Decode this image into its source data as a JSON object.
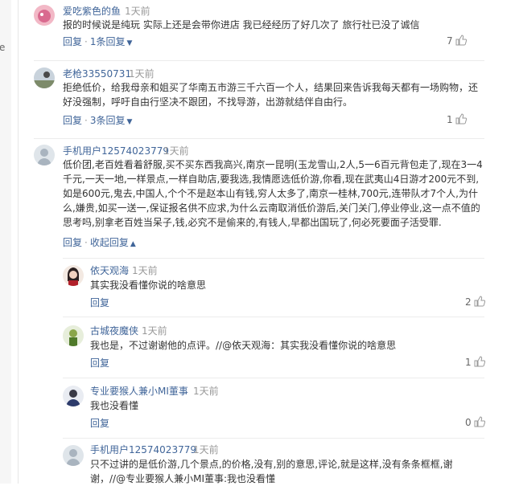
{
  "sidebar": {
    "stub": "e"
  },
  "comments": [
    {
      "user": "爱吃紫色的鱼",
      "time": "1天前",
      "text": "报的时候说是纯玩 实际上还是会带你进店 我已经经历了好几次了 旅行社已没了诚信",
      "reply": "回复",
      "expand": "1条回复",
      "likes": "7"
    },
    {
      "user": "老枪33550731",
      "time": "1天前",
      "text": "拒绝低价，给我母亲和姐买了华南五市游三千六百一个人，结果回来告诉我每天都有一场购物，还好没强制，呼吁自由行坚决不跟团，不找导游，出游就结伴自由行。",
      "reply": "回复",
      "expand": "3条回复",
      "likes": "1"
    },
    {
      "user": "手机用户12574023779",
      "time": "1天前",
      "text": "低价团,老百姓看着舒服,买不买东西我高兴,南京一昆明(玉龙雪山,2人,5一6百元背包走了,现在3一4千元,一天一地,一样景点,一样自助店,要我选,我情愿选低价游,你看,现在武夷山4日游才200元不到,如是600元,鬼去,中国人,个个不是赵本山有钱,穷人太多了,南京一桂林,700元,连带队才7个人,为什么,嫌贵,如买一送一,保证报名供不应求,为什么云南取消低价游后,关门关门,停业停业,这一点不值的思考吗,别拿老百姓当呆子,钱,必究不是偷来的,有钱人,早都出国玩了,何必死要面子活受罪.",
      "reply": "回复",
      "expand": "收起回复",
      "likes": "",
      "subreplies": [
        {
          "user": "依天观海",
          "time": "1天前",
          "text": "其实我没看懂你说的啥意思",
          "reply": "回复",
          "likes": "2"
        },
        {
          "user": "古城夜魔侠",
          "time": "1天前",
          "text": "我也是，不过谢谢他的点评。//@依天观海：其实我没看懂你说的啥意思",
          "reply": "回复",
          "likes": "1"
        },
        {
          "user": "专业要猴人兼小MI董事",
          "time": "1天前",
          "text": "我也没看懂",
          "reply": "回复",
          "likes": "0"
        },
        {
          "user": "手机用户12574023779",
          "time": "1天前",
          "text": "只不过讲的是低价游,几个景点,的价格,没有,别的意思,评论,就是这样,没有条条框框,谢谢，//@专业要猴人兼小MI董事:我也没看懂",
          "reply": "",
          "likes": ""
        }
      ]
    }
  ],
  "colors": {
    "link": "#406599",
    "meta": "#999999",
    "text": "#333333",
    "divider": "#ececec"
  }
}
